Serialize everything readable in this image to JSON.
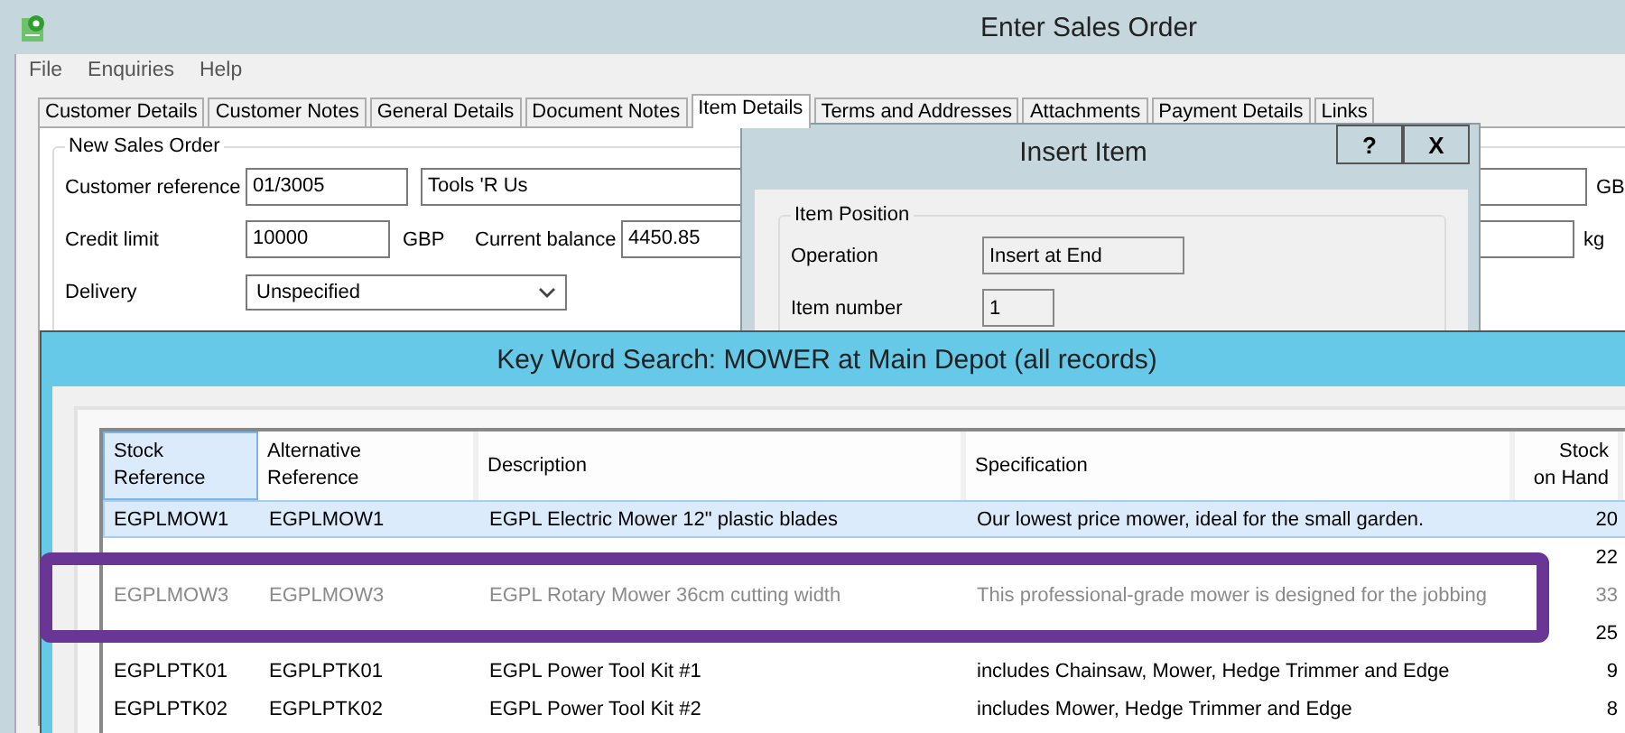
{
  "window": {
    "title": "Enter Sales Order"
  },
  "menu": [
    {
      "label": "File"
    },
    {
      "label": "Enquiries"
    },
    {
      "label": "Help"
    }
  ],
  "tabs": [
    {
      "label": "Customer Details",
      "selected": false
    },
    {
      "label": "Customer Notes",
      "selected": false
    },
    {
      "label": "General Details",
      "selected": false
    },
    {
      "label": "Document Notes",
      "selected": false
    },
    {
      "label": "Item Details",
      "selected": true
    },
    {
      "label": "Terms and Addresses",
      "selected": false
    },
    {
      "label": "Attachments",
      "selected": false
    },
    {
      "label": "Payment Details",
      "selected": false
    },
    {
      "label": "Links",
      "selected": false
    }
  ],
  "order_group": {
    "title": "New Sales Order",
    "customer_reference": {
      "label": "Customer reference",
      "value": "01/3005",
      "name": "Tools 'R Us",
      "unit": "GB"
    },
    "credit_limit": {
      "label": "Credit limit",
      "value": "10000",
      "currency": "GBP",
      "balance_label": "Current balance",
      "balance": "4450.85",
      "unit": "kg"
    },
    "delivery": {
      "label": "Delivery",
      "value": "Unspecified"
    }
  },
  "insert_dialog": {
    "title": "Insert Item",
    "buttons": [
      {
        "label": "?"
      },
      {
        "label": "X"
      }
    ],
    "group": {
      "title": "Item Position",
      "fields": [
        {
          "label": "Operation",
          "value": "Insert at End"
        },
        {
          "label": "Item number",
          "value": "1"
        }
      ]
    }
  },
  "search_dialog": {
    "title": "Key Word Search: MOWER at Main Depot (all records)",
    "columns": [
      {
        "label": "Stock\nReference",
        "selected": true
      },
      {
        "label": "Alternative\nReference",
        "selected": false
      },
      {
        "label": "Description",
        "selected": false
      },
      {
        "label": "Specification",
        "selected": false
      },
      {
        "label": "Stock\non Hand",
        "selected": false
      }
    ],
    "rows": [
      {
        "stock_reference": "EGPLMOW1",
        "alternative_reference": "EGPLMOW1",
        "description": "EGPL Electric Mower 12\" plastic blades",
        "specification": "Our lowest price mower, ideal for the small garden.",
        "stock_on_hand": "20",
        "selected": true,
        "disabled": false
      },
      {
        "stock_on_hand": "22",
        "selected": false,
        "disabled": false
      },
      {
        "stock_reference": "EGPLMOW3",
        "alternative_reference": "EGPLMOW3",
        "description": "EGPL Rotary Mower 36cm cutting width",
        "specification": "This professional-grade mower is designed for the jobbing",
        "stock_on_hand": "33",
        "selected": false,
        "disabled": true
      },
      {
        "stock_on_hand": "25",
        "selected": false,
        "disabled": false
      },
      {
        "stock_reference": "EGPLPTK01",
        "alternative_reference": "EGPLPTK01",
        "description": "EGPL Power Tool Kit #1",
        "specification": "includes Chainsaw, Mower, Hedge Trimmer and Edge",
        "stock_on_hand": "9",
        "selected": false,
        "disabled": false
      },
      {
        "stock_reference": "EGPLPTK02",
        "alternative_reference": "EGPLPTK02",
        "description": "EGPL Power Tool Kit #2",
        "specification": "includes Mower, Hedge Trimmer and Edge",
        "stock_on_hand": "8",
        "selected": false,
        "disabled": false
      }
    ]
  }
}
